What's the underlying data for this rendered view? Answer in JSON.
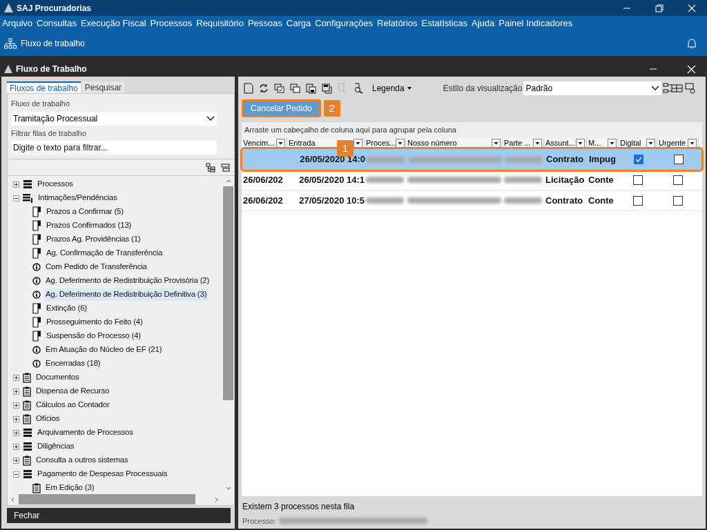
{
  "app_title": "SAJ Procuradorias",
  "menu": [
    "Arquivo",
    "Consultas",
    "Execução Fiscal",
    "Processos",
    "Requisitório",
    "Pessoas",
    "Carga",
    "Configurações",
    "Relatórios",
    "Estatísticas",
    "Ajuda",
    "Painel Indicadores"
  ],
  "toolbar_item": "Fluxo de trabalho",
  "window_title": "Fluxo de Trabalho",
  "left_tabs": [
    {
      "label": "Fluxos de trabalho",
      "selected": true
    },
    {
      "label": "Pesquisar",
      "selected": false
    }
  ],
  "workflow_label": "Fluxo de trabalho",
  "workflow_value": "Tramitação Processual",
  "filter_label": "Filtrar filas de trabalho",
  "filter_placeholder": "Digite o texto para filtrar...",
  "tree": [
    {
      "label": "Processos",
      "kind": "stack",
      "expanded": false,
      "selected": false
    },
    {
      "label": "Intimações/Pendências",
      "kind": "stack-flag",
      "expanded": true,
      "selected": false,
      "children": [
        {
          "label": "Prazos a Confirmar (5)",
          "kind": "page-flag",
          "selected": false
        },
        {
          "label": "Prazos Confirmados (13)",
          "kind": "page-flag",
          "selected": false
        },
        {
          "label": "Prazos Ag. Providências (1)",
          "kind": "page-flag",
          "selected": false
        },
        {
          "label": "Ag. Confirmação de Transferência",
          "kind": "page-flag",
          "selected": false
        },
        {
          "label": "Com Pedido de Transferência",
          "kind": "info",
          "selected": false
        },
        {
          "label": "Ag. Deferimento de Redistribuição Provisória (2)",
          "kind": "info",
          "selected": false
        },
        {
          "label": "Ag. Deferimento de Redistribuição Definitiva (3)",
          "kind": "info",
          "selected": true
        },
        {
          "label": "Extinção (6)",
          "kind": "page-flag",
          "selected": false
        },
        {
          "label": "Prosseguimento do Feito (4)",
          "kind": "page-flag",
          "selected": false
        },
        {
          "label": "Suspensão do Processo (4)",
          "kind": "page-flag",
          "selected": false
        },
        {
          "label": "Em Atuação do Núcleo de EF (21)",
          "kind": "info",
          "selected": false
        },
        {
          "label": "Encerradas (18)",
          "kind": "info",
          "selected": false
        }
      ]
    },
    {
      "label": "Documentos",
      "kind": "clipboard",
      "expanded": false,
      "selected": false
    },
    {
      "label": "Dispensa de Recurso",
      "kind": "clipboard",
      "expanded": false,
      "selected": false
    },
    {
      "label": "Cálculos ao Contador",
      "kind": "clipboard",
      "expanded": false,
      "selected": false
    },
    {
      "label": "Ofícios",
      "kind": "clipboard",
      "expanded": false,
      "selected": false
    },
    {
      "label": "Arquivamento de Processos",
      "kind": "stack",
      "expanded": false,
      "selected": false
    },
    {
      "label": "Diligências",
      "kind": "stack",
      "expanded": false,
      "selected": false
    },
    {
      "label": "Consulta a outros sistemas",
      "kind": "clipboard",
      "expanded": false,
      "selected": false
    },
    {
      "label": "Pagamento de Despesas Processuais",
      "kind": "stack",
      "expanded": true,
      "selected": false,
      "children": [
        {
          "label": "Em Edição (3)",
          "kind": "clipboard",
          "selected": false
        }
      ]
    }
  ],
  "close_button": "Fechar",
  "legend_button": "Legenda",
  "view_style_label": "Estilo da visualização",
  "view_style_value": "Padrão",
  "cancel_button": "Cancelar Pedido",
  "annotations": [
    {
      "label": "1"
    },
    {
      "label": "2"
    }
  ],
  "group_hint": "Arraste um cabeçalho de coluna aqui para agrupar pela coluna",
  "columns": [
    "Vencim...",
    "Entrada",
    "Proces...",
    "Nosso número",
    "Parte ...",
    "Assunt...",
    "M...",
    "Digital",
    "Urgente"
  ],
  "rows": [
    {
      "vencimento": "",
      "entrada": "26/05/2020 14:0",
      "assunto": "Contrato",
      "m": "Impug",
      "digital": true,
      "urgente": false,
      "selected": true
    },
    {
      "vencimento": "26/06/202",
      "entrada": "26/05/2020 14:1",
      "assunto": "Licitação",
      "m": "Conte",
      "digital": false,
      "urgente": false,
      "selected": false
    },
    {
      "vencimento": "26/06/202",
      "entrada": "27/05/2020 10:5",
      "assunto": "Contrato",
      "m": "Conte",
      "digital": false,
      "urgente": false,
      "selected": false
    }
  ],
  "status_text": "Existem 3 processos nesta fila",
  "process_label": "Processo:"
}
